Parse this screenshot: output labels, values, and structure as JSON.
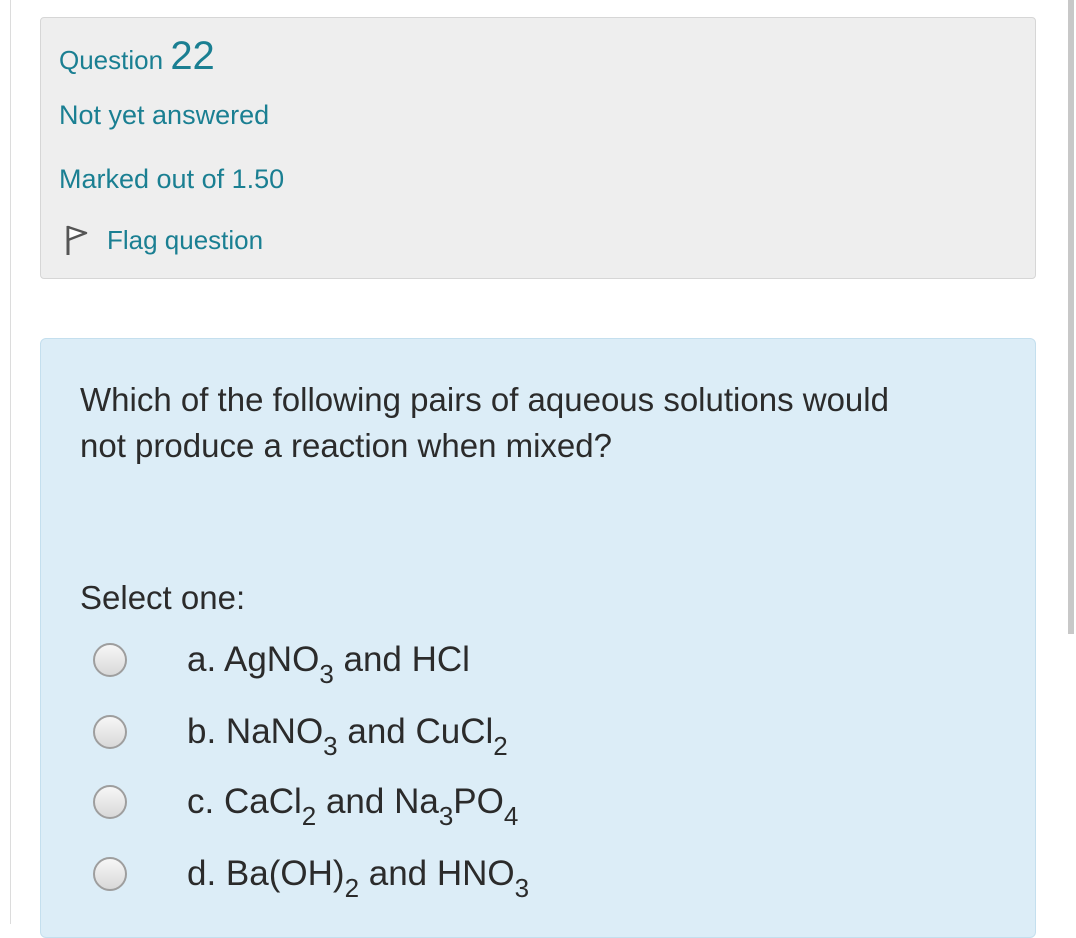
{
  "info": {
    "question_label": "Question",
    "question_number": "22",
    "state": "Not yet answered",
    "grade": "Marked out of 1.50",
    "flag_label": "Flag question",
    "flag_icon": "flag-icon"
  },
  "question": {
    "text": "Which of the following pairs of aqueous solutions would not produce a reaction when mixed?",
    "prompt": "Select one:"
  },
  "options": [
    {
      "letter": "a.",
      "parts": [
        " AgNO",
        "3",
        " and HCl",
        "",
        ""
      ],
      "selected": false
    },
    {
      "letter": "b.",
      "parts": [
        " NaNO",
        "3",
        " and CuCl",
        "2",
        ""
      ],
      "selected": false
    },
    {
      "letter": "c.",
      "parts": [
        " CaCl",
        "2",
        " and Na",
        "3",
        "PO",
        "4"
      ],
      "selected": false
    },
    {
      "letter": "d.",
      "parts": [
        " Ba(OH)",
        "2",
        " and HNO",
        "3",
        ""
      ],
      "selected": false
    }
  ],
  "colors": {
    "link_teal": "#1a7f92",
    "info_bg": "#eeeeee",
    "content_bg": "#dcedf7",
    "text": "#2b2b2b"
  }
}
